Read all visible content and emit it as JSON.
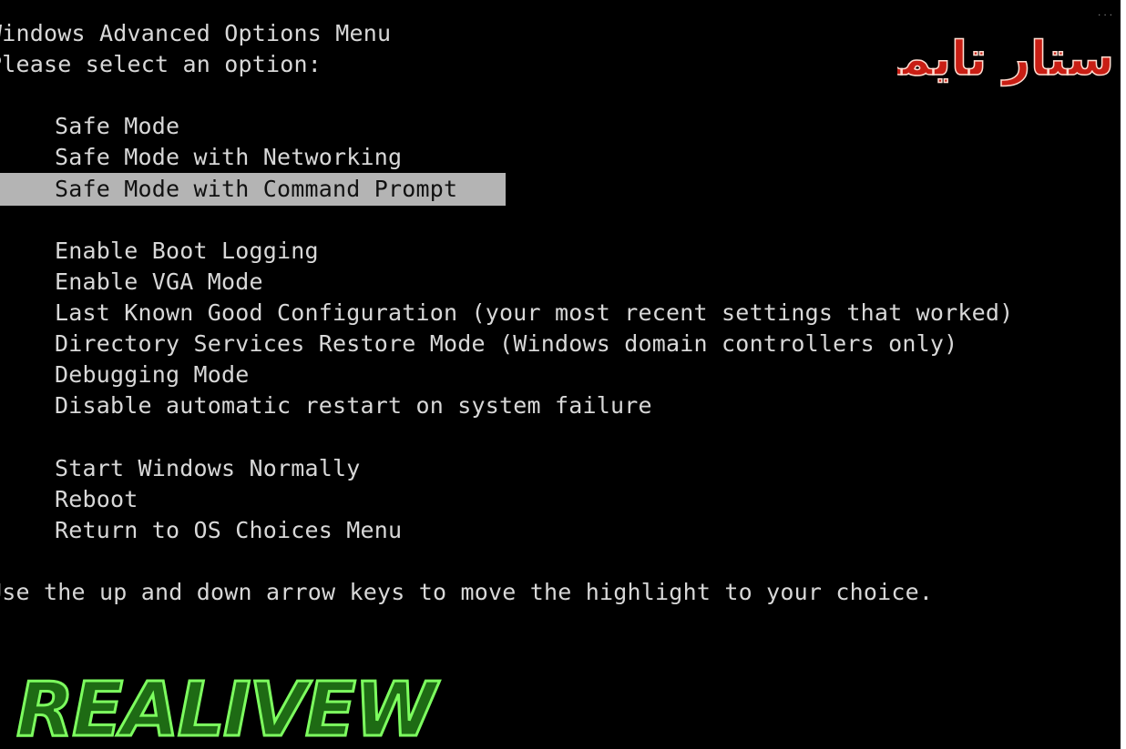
{
  "header": {
    "title": "Windows Advanced Options Menu",
    "prompt": "Please select an option:"
  },
  "menu": {
    "group1": [
      {
        "label": "Safe Mode"
      },
      {
        "label": "Safe Mode with Networking"
      },
      {
        "label": "Safe Mode with Command Prompt",
        "selected": true
      }
    ],
    "group2": [
      {
        "label": "Enable Boot Logging"
      },
      {
        "label": "Enable VGA Mode"
      },
      {
        "label": "Last Known Good Configuration (your most recent settings that worked)"
      },
      {
        "label": "Directory Services Restore Mode (Windows domain controllers only)"
      },
      {
        "label": "Debugging Mode"
      },
      {
        "label": "Disable automatic restart on system failure"
      }
    ],
    "group3": [
      {
        "label": "Start Windows Normally"
      },
      {
        "label": "Reboot"
      },
      {
        "label": "Return to OS Choices Menu"
      }
    ]
  },
  "footer": {
    "hint": "Use the up and down arrow keys to move the highlight to your choice."
  },
  "watermarks": {
    "top_right_logo": "ستار تايمز",
    "bottom_left_logo": "REALIVEW"
  },
  "colors": {
    "background": "#000000",
    "text": "#d8d8d8",
    "highlight_bg": "#b4b4b4",
    "highlight_text": "#111111",
    "logo_red": "#c81e14",
    "logo_green": "#3fbf2f"
  }
}
